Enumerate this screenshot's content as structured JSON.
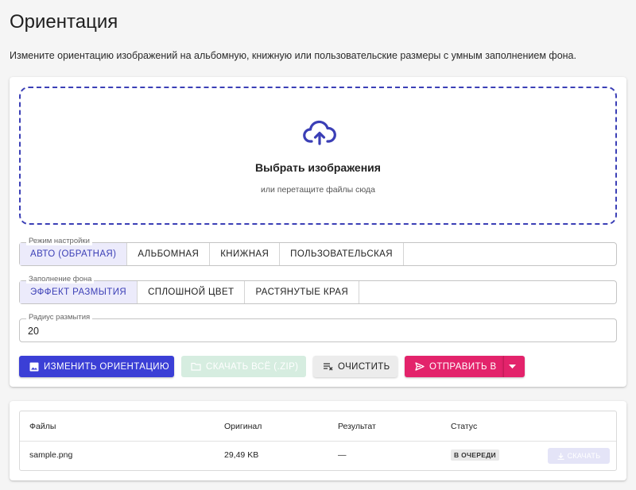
{
  "page": {
    "title": "Ориентация",
    "description": "Измените ориентацию изображений на альбомную, книжную или пользовательские размеры с умным заполнением фона."
  },
  "dropzone": {
    "icon": "cloud-upload-icon",
    "title": "Выбрать изображения",
    "subtitle": "или перетащите файлы сюда"
  },
  "mode": {
    "legend": "Режим настройки",
    "options": [
      "АВТО (ОБРАТНАЯ)",
      "АЛЬБОМНАЯ",
      "КНИЖНАЯ",
      "ПОЛЬЗОВАТЕЛЬСКАЯ"
    ],
    "selected": "АВТО (ОБРАТНАЯ)"
  },
  "fill": {
    "legend": "Заполнение фона",
    "options": [
      "ЭФФЕКТ РАЗМЫТИЯ",
      "СПЛОШНОЙ ЦВЕТ",
      "РАСТЯНУТЫЕ КРАЯ"
    ],
    "selected": "ЭФФЕКТ РАЗМЫТИЯ"
  },
  "radius": {
    "legend": "Радиус размытия",
    "value": "20"
  },
  "actions": {
    "rotate": "ИЗМЕНИТЬ ОРИЕНТАЦИЮ",
    "download_zip": "СКАЧАТЬ ВСЁ (.ZIP)",
    "clear": "ОЧИСТИТЬ",
    "send": "ОТПРАВИТЬ В"
  },
  "files_table": {
    "headers": {
      "files": "Файлы",
      "original": "Оригинал",
      "result": "Результат",
      "status": "Статус"
    },
    "rows": [
      {
        "name": "sample.png",
        "original": "29,49 KB",
        "result": "—",
        "status": "В ОЧЕРЕДИ",
        "download": "СКАЧАТЬ"
      }
    ]
  },
  "colors": {
    "accent": "#3b3fd6",
    "send": "#e3236b",
    "zip_disabled": "#d6ede0",
    "dropzone_border": "#3b3fb6"
  }
}
